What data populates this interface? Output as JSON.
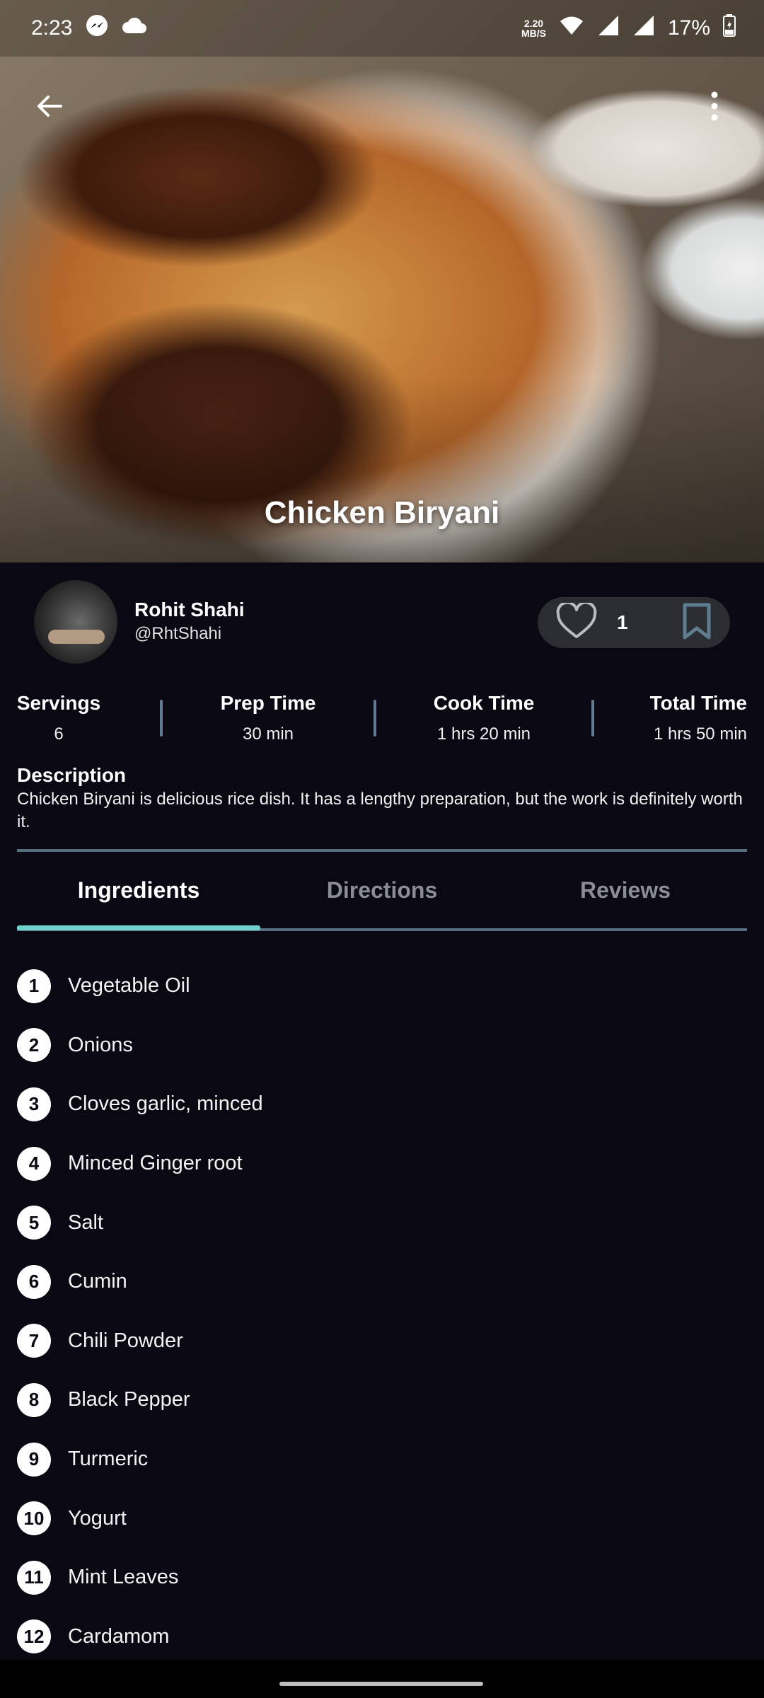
{
  "status_bar": {
    "time": "2:23",
    "net_speed_value": "2.20",
    "net_speed_unit": "MB/S",
    "battery": "17%"
  },
  "recipe": {
    "title": "Chicken Biryani",
    "author_name": "Rohit Shahi",
    "author_handle": "@RhtShahi",
    "likes": "1"
  },
  "stats": [
    {
      "label": "Servings",
      "value": "6"
    },
    {
      "label": "Prep Time",
      "value": "30 min"
    },
    {
      "label": "Cook Time",
      "value": "1 hrs 20 min"
    },
    {
      "label": "Total Time",
      "value": "1 hrs 50 min"
    }
  ],
  "description": {
    "title": "Description",
    "text": "Chicken Biryani is delicious rice dish. It has a lengthy preparation, but the work is definitely worth it."
  },
  "tabs": [
    {
      "label": "Ingredients",
      "active": true
    },
    {
      "label": "Directions",
      "active": false
    },
    {
      "label": "Reviews",
      "active": false
    }
  ],
  "ingredients": [
    {
      "num": "1",
      "name": "Vegetable Oil"
    },
    {
      "num": "2",
      "name": "Onions"
    },
    {
      "num": "3",
      "name": "Cloves garlic, minced"
    },
    {
      "num": "4",
      "name": "Minced Ginger root"
    },
    {
      "num": "5",
      "name": "Salt"
    },
    {
      "num": "6",
      "name": "Cumin"
    },
    {
      "num": "7",
      "name": "Chili Powder"
    },
    {
      "num": "8",
      "name": "Black Pepper"
    },
    {
      "num": "9",
      "name": "Turmeric"
    },
    {
      "num": "10",
      "name": "Yogurt"
    },
    {
      "num": "11",
      "name": "Mint Leaves"
    },
    {
      "num": "12",
      "name": "Cardamom"
    }
  ],
  "colors": {
    "background": "#0a0812",
    "accent": "#6fd3cc",
    "divider": "#54707f",
    "pill": "#2b2d33",
    "bookmark": "#5f7d8f"
  }
}
